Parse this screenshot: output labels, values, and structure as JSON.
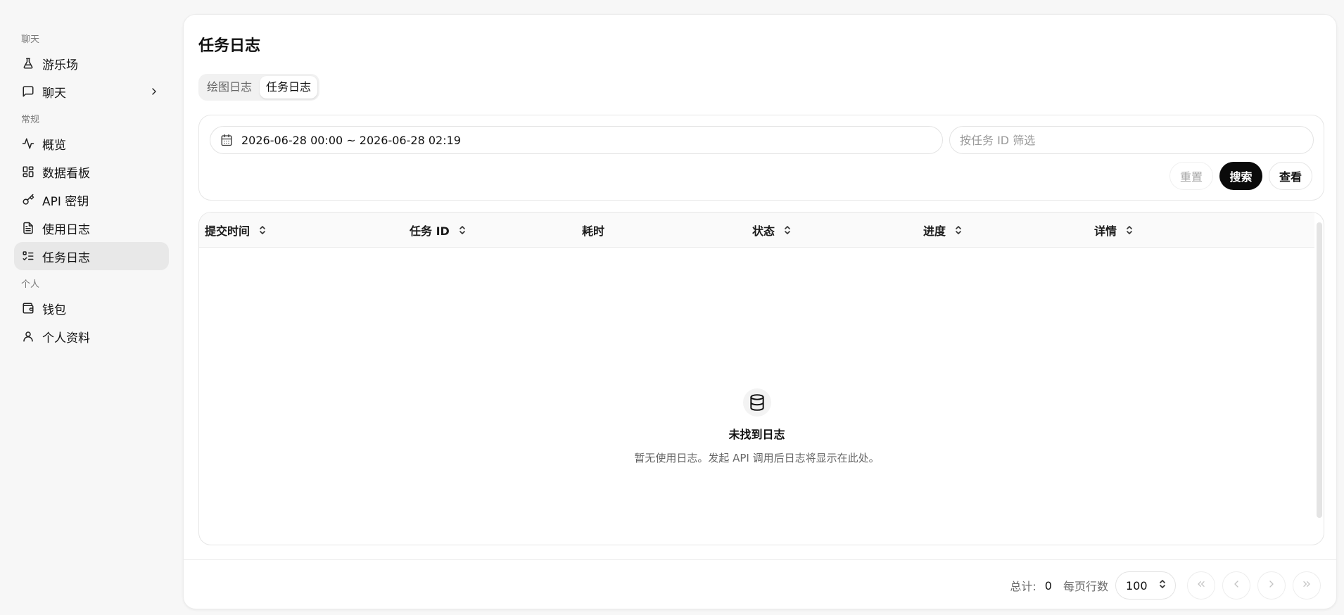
{
  "sidebar": {
    "sections": [
      {
        "title": "聊天",
        "items": [
          {
            "label": "游乐场",
            "icon": "flask-icon"
          },
          {
            "label": "聊天",
            "icon": "message-square-icon",
            "has_chevron": true
          }
        ]
      },
      {
        "title": "常规",
        "items": [
          {
            "label": "概览",
            "icon": "activity-icon"
          },
          {
            "label": "数据看板",
            "icon": "dashboard-grid-icon"
          },
          {
            "label": "API 密钥",
            "icon": "key-icon"
          },
          {
            "label": "使用日志",
            "icon": "file-text-icon"
          },
          {
            "label": "任务日志",
            "icon": "list-checks-icon",
            "active": true
          }
        ]
      },
      {
        "title": "个人",
        "items": [
          {
            "label": "钱包",
            "icon": "wallet-icon"
          },
          {
            "label": "个人资料",
            "icon": "user-icon"
          }
        ]
      }
    ]
  },
  "main": {
    "title": "任务日志",
    "tabs": [
      {
        "label": "绘图日志",
        "active": false
      },
      {
        "label": "任务日志",
        "active": true
      }
    ],
    "filters": {
      "date_range": "2026-06-28 00:00 ~ 2026-06-28 02:19",
      "task_id_placeholder": "按任务 ID 筛选",
      "task_id_value": "",
      "reset_label": "重置",
      "search_label": "搜索",
      "view_label": "查看"
    },
    "table": {
      "columns": [
        {
          "label": "提交时间",
          "sortable": true
        },
        {
          "label": "任务 ID",
          "sortable": true
        },
        {
          "label": "耗时",
          "sortable": false
        },
        {
          "label": "状态",
          "sortable": true
        },
        {
          "label": "进度",
          "sortable": true
        },
        {
          "label": "详情",
          "sortable": true
        }
      ],
      "rows": [],
      "empty_title": "未找到日志",
      "empty_desc": "暂无使用日志。发起 API 调用后日志将显示在此处。"
    },
    "footer": {
      "total_label": "总计:",
      "total_count": "0",
      "rows_per_page_label": "每页行数",
      "rows_per_page": "100"
    }
  },
  "colors": {
    "accent": "#0a0a0a",
    "active_nav_bg": "#e8e8e8",
    "page_bg": "#f7f7f7"
  }
}
